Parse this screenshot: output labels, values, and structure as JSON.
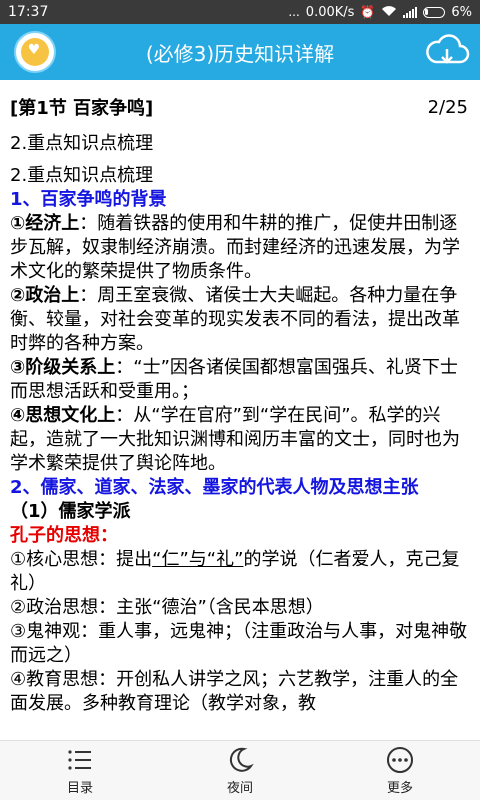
{
  "status_bar": {
    "time": "17:37",
    "dots": "...",
    "speed": "0.00K/s",
    "battery_pct": "6%"
  },
  "app_bar": {
    "title": "(必修3)历史知识详解",
    "logo_icon": "app-logo-icon",
    "cloud_icon": "cloud-download-icon"
  },
  "section": {
    "title": "[第1节 百家争鸣]",
    "page": "2/25"
  },
  "sub_heading": "2.重点知识点梳理",
  "article": {
    "l0": "2.重点知识点梳理",
    "h1": "1、百家争鸣的背景",
    "p1_label": "①经济上",
    "p1_text": "：随着铁器的使用和牛耕的推广，促使井田制逐步瓦解，奴隶制经济崩溃。而封建经济的迅速发展，为学术文化的繁荣提供了物质条件。",
    "p2_label": "②政治上",
    "p2_text": "：周王室衰微、诸侯士大夫崛起。各种力量在争衡、较量，对社会变革的现实发表不同的看法，提出改革时弊的各种方案。",
    "p3_label": "③阶级关系上",
    "p3_text": "：“士”因各诸侯国都想富国强兵、礼贤下士而思想活跃和受重用。；",
    "p4_label": "④思想文化上",
    "p4_text": "：从“学在官府”到“学在民间”。私学的兴起，造就了一大批知识渊博和阅历丰富的文士，同时也为学术繁荣提供了舆论阵地。",
    "h2": "2、儒家、道家、法家、墨家的代表人物及思想主张",
    "h3": "（1）儒家学派",
    "red1": "孔子的思想：",
    "q1_a": "①核心思想：提出",
    "q1_u": "“仁”与“礼”",
    "q1_b": "的学说（仁者爱人，克己复礼）",
    "q2": "②政治思想：主张“德治”（含民本思想）",
    "q3": "③鬼神观：重人事，远鬼神；（注重政治与人事，对鬼神敬而远之）",
    "q4": "④教育思想：开创私人讲学之风；六艺教学，注重人的全面发展。多种教育理论（教学对象，教"
  },
  "bottom_nav": [
    {
      "label": "目录",
      "icon": "menu-list-icon"
    },
    {
      "label": "夜间",
      "icon": "moon-icon"
    },
    {
      "label": "更多",
      "icon": "more-dots-icon"
    }
  ],
  "colors": {
    "app_bar": "#27a9e1",
    "heading_blue": "#1515e0",
    "heading_red": "#e60000",
    "status_bar": "#3a3a3a"
  }
}
